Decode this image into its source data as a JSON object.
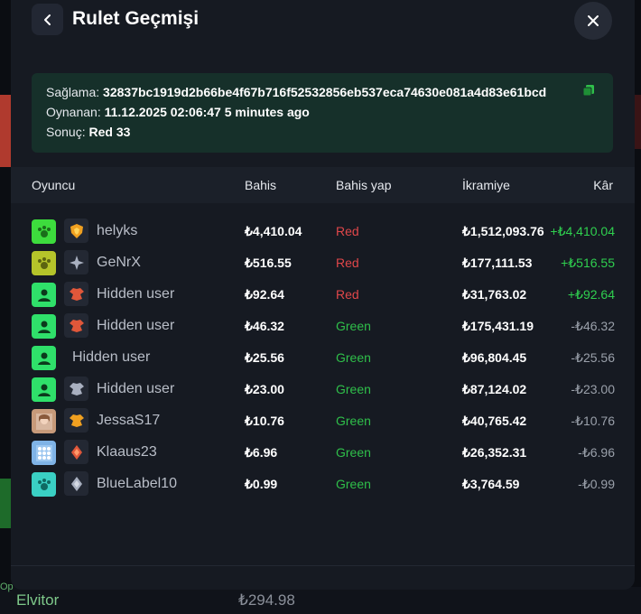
{
  "header": {
    "title": "Rulet Geçmişi"
  },
  "info": {
    "hash_label": "Sağlama:",
    "hash_value": "32837bc1919d2b66be4f67b716f52532856eb537eca74630e081a4d83e61bcd",
    "played_label": "Oynanan:",
    "played_value": "11.12.2025 02:06:47 5 minutes ago",
    "result_label": "Sonuç:",
    "result_value": "Red 33"
  },
  "table": {
    "headers": {
      "player": "Oyuncu",
      "bet": "Bahis",
      "choice": "Bahis yap",
      "prize": "İkramiye",
      "profit": "Kâr"
    },
    "rows": [
      {
        "name": "helyks",
        "bet": "₺4,410.04",
        "choice": "Red",
        "prize": "₺1,512,093.76",
        "profit": "+₺4,410.04"
      },
      {
        "name": "GeNrX",
        "bet": "₺516.55",
        "choice": "Red",
        "prize": "₺177,111.53",
        "profit": "+₺516.55"
      },
      {
        "name": "Hidden user",
        "bet": "₺92.64",
        "choice": "Red",
        "prize": "₺31,763.02",
        "profit": "+₺92.64"
      },
      {
        "name": "Hidden user",
        "bet": "₺46.32",
        "choice": "Green",
        "prize": "₺175,431.19",
        "profit": "-₺46.32"
      },
      {
        "name": "Hidden user",
        "bet": "₺25.56",
        "choice": "Green",
        "prize": "₺96,804.45",
        "profit": "-₺25.56"
      },
      {
        "name": "Hidden user",
        "bet": "₺23.00",
        "choice": "Green",
        "prize": "₺87,124.02",
        "profit": "-₺23.00"
      },
      {
        "name": "JessaS17",
        "bet": "₺10.76",
        "choice": "Green",
        "prize": "₺40,765.42",
        "profit": "-₺10.76"
      },
      {
        "name": "Klaaus23",
        "bet": "₺6.96",
        "choice": "Green",
        "prize": "₺26,352.31",
        "profit": "-₺6.96"
      },
      {
        "name": "BlueLabel10",
        "bet": "₺0.99",
        "choice": "Green",
        "prize": "₺3,764.59",
        "profit": "-₺0.99"
      }
    ]
  },
  "background": {
    "player_name": "Elvitor",
    "amount": "₺294.98",
    "label": "Op"
  },
  "colors": {
    "red": "#e0474a",
    "green": "#2fbf4a",
    "positive": "#2fcf4f",
    "negative": "#9aa0aa",
    "info_bg": "#16302a"
  }
}
